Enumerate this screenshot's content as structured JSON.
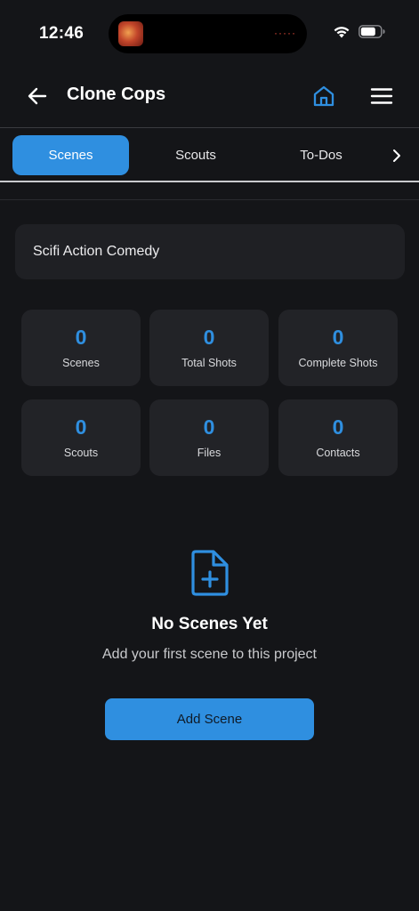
{
  "status_bar": {
    "time": "12:46"
  },
  "header": {
    "title": "Clone Cops"
  },
  "tabs": [
    {
      "label": "Scenes",
      "active": true
    },
    {
      "label": "Scouts",
      "active": false
    },
    {
      "label": "To-Dos",
      "active": false
    }
  ],
  "project": {
    "genre": "Scifi Action Comedy"
  },
  "stats": [
    {
      "value": "0",
      "label": "Scenes"
    },
    {
      "value": "0",
      "label": "Total Shots"
    },
    {
      "value": "0",
      "label": "Complete Shots"
    },
    {
      "value": "0",
      "label": "Scouts"
    },
    {
      "value": "0",
      "label": "Files"
    },
    {
      "value": "0",
      "label": "Contacts"
    }
  ],
  "empty_state": {
    "title": "No Scenes Yet",
    "subtitle": "Add your first scene to this project",
    "button_label": "Add Scene",
    "icon": "file-plus-icon"
  },
  "colors": {
    "accent": "#2f8fe0",
    "background": "#141518",
    "card": "#222327"
  }
}
